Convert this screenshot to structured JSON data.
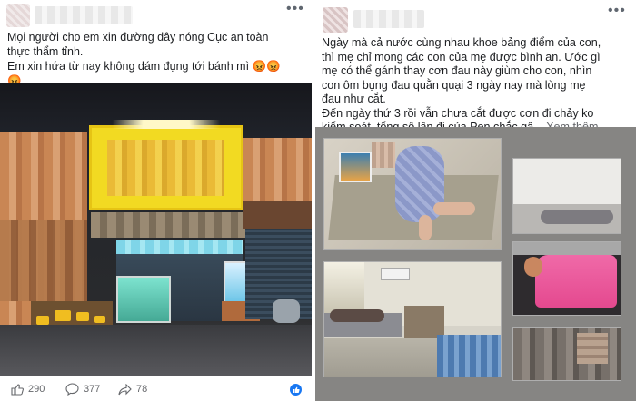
{
  "left_post": {
    "text_lines": [
      "Mọi người cho em xin đường dây nóng Cục an toàn",
      "thực thẩm tỉnh.",
      "Em xin hứa từ nay không dám đụng tới bánh mì 😡😡",
      "😡"
    ],
    "reactions": {
      "likes": "290",
      "comments": "377",
      "shares": "78"
    }
  },
  "right_post": {
    "text_lines": [
      "Ngày mà cả nước cùng nhau khoe bảng điểm của con,",
      "thì mẹ chỉ mong các con của mẹ được bình an. Ước gì",
      "mẹ có thể gánh thay cơn đau này giùm cho con, nhìn",
      "con ôm bụng đau quằn quại 3 ngày nay mà lòng mẹ",
      "đau như cắt.",
      "Đến ngày thứ 3 rồi vẫn chưa cắt được cơn đi chảy ko",
      "kiểm soát, tổng số lần đi của Pen chắc gấ..."
    ],
    "see_more": "Xem thêm"
  },
  "icons": {
    "more": "more-dots-icon",
    "like": "like-thumb-icon",
    "comment": "comment-bubble-icon",
    "share": "share-arrow-icon"
  },
  "colors": {
    "facebook_blue": "#1877f2",
    "text": "#1c1e21",
    "muted": "#65676b"
  }
}
